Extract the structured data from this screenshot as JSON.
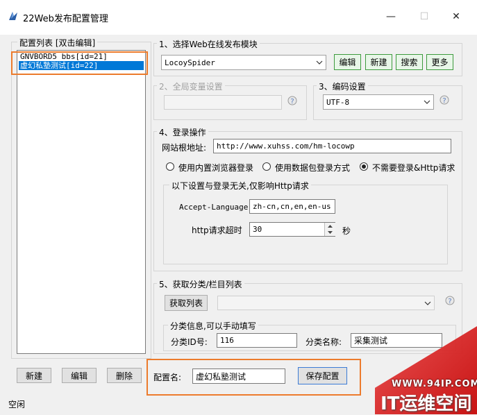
{
  "window": {
    "title": "22Web发布配置管理",
    "min": "—",
    "max": "☐",
    "close": "✕"
  },
  "left": {
    "group_title": "配置列表  [双击编辑]",
    "items": [
      "GNVBORD5 bbs[id=21]",
      "虚幻私塾测试[id=22]"
    ],
    "selected_index": 1,
    "buttons": {
      "new": "新建",
      "edit": "编辑",
      "delete": "删除"
    }
  },
  "section1": {
    "title": "1、选择Web在线发布模块",
    "module": "LocoySpider",
    "buttons": {
      "edit": "编辑",
      "new": "新建",
      "search": "搜索",
      "more": "更多"
    }
  },
  "section2": {
    "title": "2、全局变量设置",
    "value": ""
  },
  "section3": {
    "title": "3、编码设置",
    "encoding": "UTF-8"
  },
  "section4": {
    "title": "4、登录操作",
    "url_label": "网站根地址:",
    "url_value": "http://www.xuhss.com/hm-locowp",
    "radio_builtin": "使用内置浏览器登录",
    "radio_packet": "使用数据包登录方式",
    "radio_none": "不需要登录&Http请求",
    "selected": "none",
    "sub_title": "以下设置与登录无关,仅影响Http请求",
    "lang_label": "Accept-Language",
    "lang_value": "zh-cn,cn,en,en-us",
    "timeout_label": "http请求超时",
    "timeout_value": "30",
    "timeout_unit": "秒"
  },
  "section5": {
    "title": "5、获取分类/栏目列表",
    "fetch_button": "获取列表",
    "category_value": "",
    "info_title": "分类信息,可以手动填写",
    "id_label": "分类ID号:",
    "id_value": "116",
    "name_label": "分类名称:",
    "name_value": "采集测试"
  },
  "bottom": {
    "config_name_label": "配置名:",
    "config_name_value": "虚幻私塾测试",
    "save_button": "保存配置"
  },
  "status": {
    "text": "空闲"
  },
  "watermark": {
    "site": "WWW.94IP.COM",
    "brand": "IT运维空间"
  },
  "colors": {
    "highlight": "#ec7b2c",
    "selection": "#0078d7",
    "watermark": "#cc1f1f"
  }
}
